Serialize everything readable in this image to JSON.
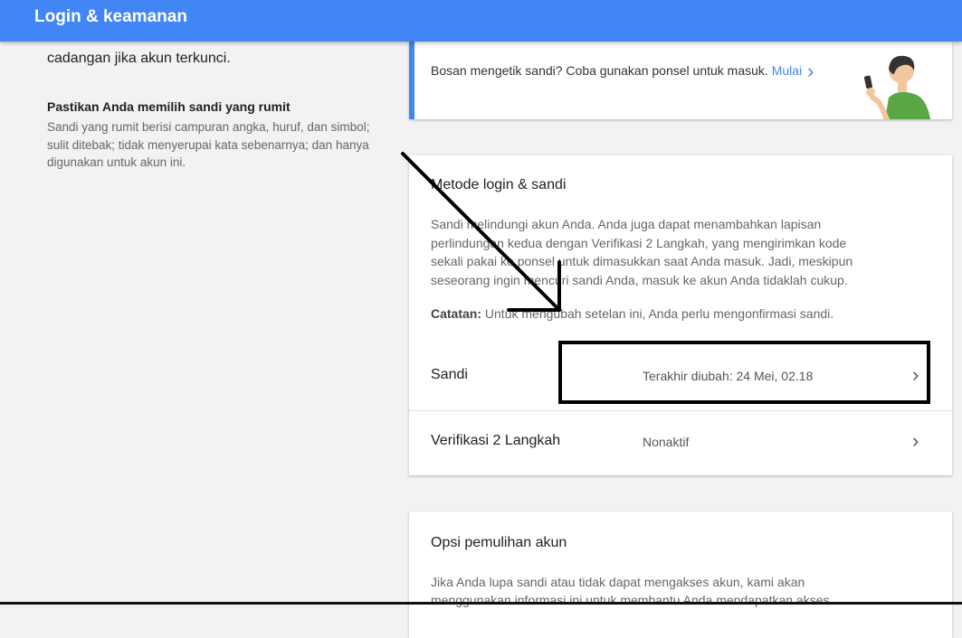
{
  "header": {
    "title": "Login & keamanan"
  },
  "left_panel": {
    "cut_text": "cadangan jika akun terkunci.",
    "tip_title": "Pastikan Anda memilih sandi yang rumit",
    "tip_body": "Sandi yang rumit berisi campuran angka, huruf, dan simbol; sulit ditebak; tidak menyerupai kata sebenarnya; dan hanya digunakan untuk akun ini."
  },
  "promo": {
    "text": "Bosan mengetik sandi? Coba gunakan ponsel untuk masuk.",
    "link": "Mulai",
    "icon": "chevron-right-icon",
    "accent": "#4285f4"
  },
  "signin_section": {
    "title": "Metode login & sandi",
    "description": "Sandi melindungi akun Anda. Anda juga dapat menambahkan lapisan perlindungan kedua dengan Verifikasi 2 Langkah, yang mengirimkan kode sekali pakai ke ponsel untuk dimasukkan saat Anda masuk. Jadi, meskipun seseorang ingin mencuri sandi Anda, masuk ke akun Anda tidaklah cukup.",
    "note_label": "Catatan:",
    "note_text": " Untuk mengubah setelan ini, Anda perlu mengonfirmasi sandi.",
    "rows": [
      {
        "label": "Sandi",
        "value": "Terakhir diubah: 24 Mei, 02.18"
      },
      {
        "label": "Verifikasi 2 Langkah",
        "value": "Nonaktif"
      }
    ]
  },
  "recovery_section": {
    "title": "Opsi pemulihan akun",
    "description": "Jika Anda lupa sandi atau tidak dapat mengakses akun, kami akan menggunakan informasi ini untuk membantu Anda mendapatkan akses"
  },
  "icons": {
    "chevron": "›",
    "row_chevron": "chevron-right-icon",
    "illustration": "person-with-phone-icon",
    "annotation": "arrow-annotation-icon"
  }
}
